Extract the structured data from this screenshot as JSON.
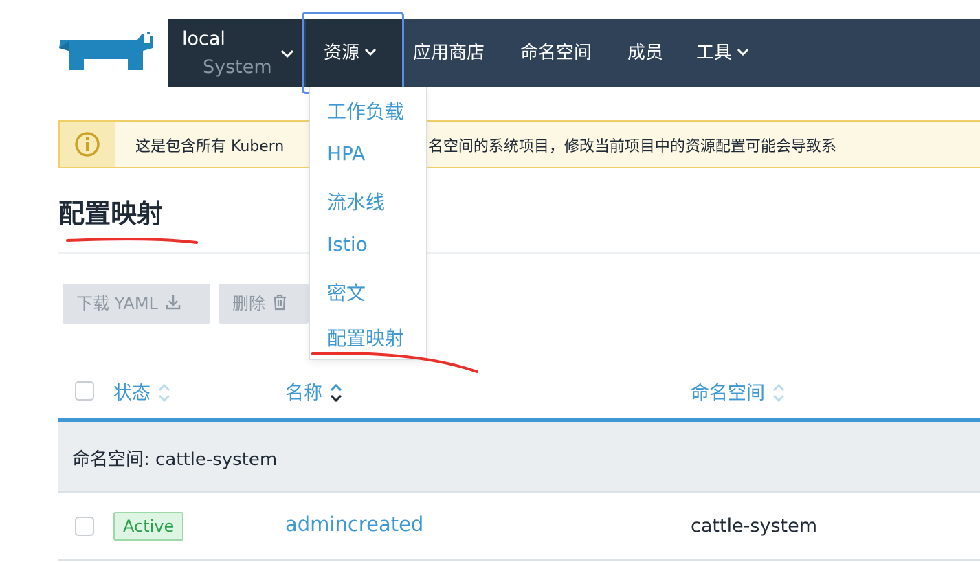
{
  "topnav": {
    "cluster_name": "local",
    "cluster_project": "System",
    "items": [
      {
        "label": "资源"
      },
      {
        "label": "应用商店"
      },
      {
        "label": "命名空间"
      },
      {
        "label": "成员"
      },
      {
        "label": "工具"
      }
    ]
  },
  "resources_menu": {
    "items": [
      {
        "label": "工作负载"
      },
      {
        "label": "HPA"
      },
      {
        "label": "流水线"
      },
      {
        "label": "Istio"
      },
      {
        "label": "密文"
      },
      {
        "label": "配置映射"
      }
    ]
  },
  "banner": {
    "icon": "info-icon",
    "text_left": "这是包含所有 Kubern",
    "text_right": "her 系统命名空间的系统项目，修改当前项目中的资源配置可能会导致系"
  },
  "page": {
    "title": "配置映射"
  },
  "toolbar": {
    "download_label": "下载 YAML",
    "delete_label": "删除"
  },
  "table": {
    "headers": {
      "state": "状态",
      "name": "名称",
      "namespace": "命名空间"
    },
    "groups": [
      {
        "label": "命名空间: cattle-system",
        "rows": [
          {
            "state": "Active",
            "name": "admincreated",
            "namespace": "cattle-system"
          }
        ]
      }
    ]
  },
  "colors": {
    "nav_bg": "#2f4257",
    "nav_active_bg": "#23303e",
    "link_blue": "#3d98d3",
    "warning_border": "#f1cf68",
    "active_green": "#2aa14a",
    "annotation_red": "#e8322b"
  }
}
